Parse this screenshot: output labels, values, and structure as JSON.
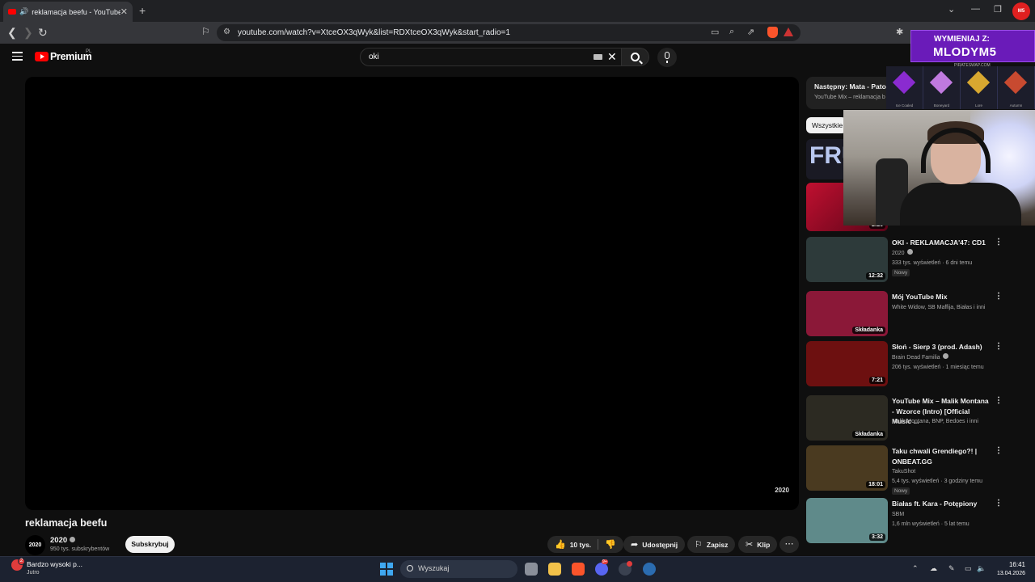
{
  "browser": {
    "tab_title": "reklamacja beefu - YouTube",
    "url": "youtube.com/watch?v=XtceOX3qWyk&list=RDXtceOX3qWyk&start_radio=1"
  },
  "masthead": {
    "logo_text": "Premium",
    "region": "PL",
    "search_value": "oki"
  },
  "player": {
    "watermark": "2020"
  },
  "video": {
    "title": "reklamacja beefu",
    "channel_avatar_text": "2020",
    "channel_name": "2020",
    "subscribers": "950 tys. subskrybentów",
    "subscribe_label": "Subskrybuj",
    "likes": "10 tys.",
    "share_label": "Udostępnij",
    "save_label": "Zapisz",
    "clip_label": "Klip"
  },
  "sidebar": {
    "next_up_title": "Następny: Mata - Patore",
    "next_up_subtitle": "YouTube Mix – reklamacja b",
    "chip_all": "Wszystkie",
    "first_thumb_text": "FRU",
    "second_badge": "2:26",
    "items": [
      {
        "title": "OKI - REKLAMACJA'47: CD1",
        "channel": "2020",
        "verified": true,
        "stats": "333 tys. wyświetleń · 6 dni temu",
        "badge": "Nowy",
        "duration": "12:32",
        "thumb_color": "#2d3a3a"
      },
      {
        "title": "Mój YouTube Mix",
        "channel": "White Widow, SB Maffija, Białas i inni",
        "verified": false,
        "stats": "",
        "badge": "",
        "duration": "Składanka",
        "thumb_color": "#8b1838"
      },
      {
        "title": "Słoń - Sierp 3 (prod. Adash)",
        "channel": "Brain Dead Familia",
        "verified": true,
        "stats": "206 tys. wyświetleń · 1 miesiąc temu",
        "badge": "",
        "duration": "7:21",
        "thumb_color": "#6d1010"
      },
      {
        "title": "YouTube Mix – Malik Montana - Wzorce (Intro) [Official Music ...",
        "channel": "Malik Montana, BNP, Bedoes i inni",
        "verified": false,
        "stats": "",
        "badge": "",
        "duration": "Składanka",
        "thumb_color": "#2c2a22"
      },
      {
        "title": "Taku chwali Grendiego?! | ONBEAT.GG",
        "channel": "TakuShot",
        "verified": false,
        "stats": "5,4 tys. wyświetleń · 3 godziny temu",
        "badge": "Nowy",
        "duration": "18:01",
        "thumb_color": "#4a3a20"
      },
      {
        "title": "Białas ft. Kara - Potępiony",
        "channel": "SBM",
        "verified": false,
        "stats": "1,6 mln wyświetleń · 5 lat temu",
        "badge": "",
        "duration": "3:32",
        "thumb_color": "#5f8a8a"
      }
    ]
  },
  "overlay": {
    "promo_line1": "WYMIENIAJ Z:",
    "promo_line2": "MLODYM5",
    "promo_site": "PIRATESWAP.COM",
    "streamer_logo": "M5",
    "skins": [
      "Ice Coaled",
      "Boneyard",
      "Lore",
      "Autumn"
    ]
  },
  "taskbar": {
    "weather_line1": "Bardzo wysoki p...",
    "weather_line2": "Jutro",
    "weather_badge": "2",
    "search_placeholder": "Wyszukaj",
    "discord_badge": "9+",
    "time": "16:41",
    "date": "13.04.2026"
  }
}
